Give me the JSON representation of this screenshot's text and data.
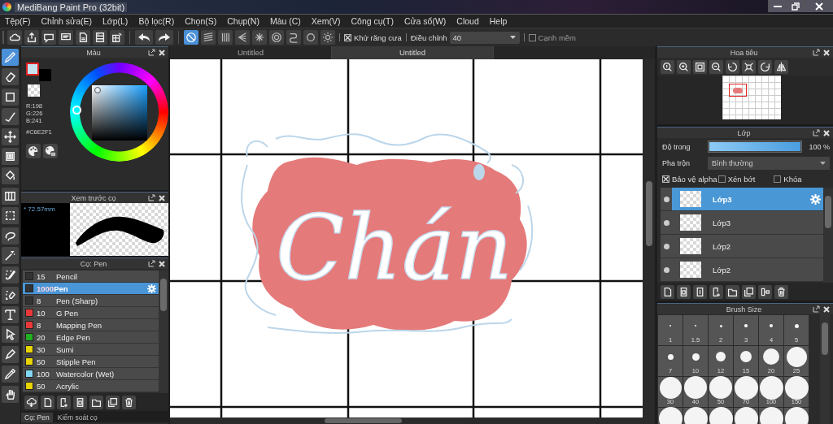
{
  "window": {
    "title": "MediBang Paint Pro (32bit)"
  },
  "menu": [
    "Tệp(F)",
    "Chỉnh sửa(E)",
    "Lớp(L)",
    "Bộ lọc(R)",
    "Chọn(S)",
    "Chụp(N)",
    "Màu (C)",
    "Xem(V)",
    "Công cụ(T)",
    "Cửa sổ(W)",
    "Cloud",
    "Help"
  ],
  "toolbar": {
    "snaps": [
      {
        "selected": true
      },
      {
        "selected": false
      },
      {
        "selected": false
      },
      {
        "selected": false
      },
      {
        "selected": false
      },
      {
        "selected": false
      },
      {
        "selected": false
      },
      {
        "selected": false
      },
      {
        "selected": false
      }
    ],
    "antialias": {
      "label": "Khử răng cưa",
      "checked": true
    },
    "correction": {
      "label": "Điều chỉnh",
      "value": "40"
    },
    "soft_edge": {
      "label": "Cạnh mềm",
      "checked": false
    }
  },
  "tools": [
    {
      "selected": true
    },
    {
      "selected": false
    },
    {
      "selected": false
    },
    {
      "selected": false
    },
    {
      "selected": false
    },
    {
      "selected": false
    },
    {
      "selected": false
    },
    {
      "selected": false
    },
    {
      "selected": false
    },
    {
      "selected": false
    },
    {
      "selected": false
    },
    {
      "selected": false
    },
    {
      "selected": false
    },
    {
      "selected": false
    },
    {
      "selected": false
    },
    {
      "selected": false
    },
    {
      "selected": false
    },
    {
      "selected": false
    }
  ],
  "color_panel": {
    "title": "Màu",
    "r": "R:198",
    "g": "G:226",
    "b": "B:241",
    "hex": "#C6E2F1"
  },
  "brush_preview": {
    "title": "Xem trước cọ",
    "size": "* 72.57mm"
  },
  "brushes": {
    "title": "Cọ: Pen",
    "items": [
      {
        "size": "15",
        "name": "Pencil",
        "color": "#333333",
        "selected": false
      },
      {
        "size": "1000",
        "name": "Pen",
        "color": "#333333",
        "selected": true
      },
      {
        "size": "8",
        "name": "Pen (Sharp)",
        "color": "#333333",
        "selected": false
      },
      {
        "size": "10",
        "name": "G Pen",
        "color": "#e83838",
        "selected": false
      },
      {
        "size": "8",
        "name": "Mapping Pen",
        "color": "#e83838",
        "selected": false
      },
      {
        "size": "20",
        "name": "Edge Pen",
        "color": "#20b020",
        "selected": false
      },
      {
        "size": "30",
        "name": "Sumi",
        "color": "#e8d400",
        "selected": false
      },
      {
        "size": "50",
        "name": "Stipple Pen",
        "color": "#e8d400",
        "selected": false
      },
      {
        "size": "100",
        "name": "Watercolor (Wet)",
        "color": "#80d8f4",
        "selected": false
      },
      {
        "size": "50",
        "name": "Acrylic",
        "color": "#e8d400",
        "selected": false
      }
    ]
  },
  "bottom_tabs": [
    {
      "label": "Cọ: Pen",
      "selected": true
    },
    {
      "label": "Kiểm soát cọ",
      "selected": false
    }
  ],
  "canvas": {
    "tabs": [
      {
        "label": "Untitled",
        "selected": false
      },
      {
        "label": "Untitled",
        "selected": true
      }
    ],
    "lettering": "Chán"
  },
  "navigator": {
    "title": "Hoa tiêu"
  },
  "layers": {
    "title": "Lớp",
    "opacity_label": "Độ trong",
    "level": 1,
    "opacity": "100 %",
    "blend_label": "Pha trộn",
    "blend": "Bình thường",
    "options": [
      {
        "label": "Bảo vệ alpha",
        "checked": true
      },
      {
        "label": "Xén bớt",
        "checked": false
      },
      {
        "label": "Khóa",
        "checked": false
      }
    ],
    "items": [
      {
        "name": "Lớp3",
        "selected": true
      },
      {
        "name": "Lớp3",
        "selected": false
      },
      {
        "name": "Lớp2",
        "selected": false
      },
      {
        "name": "Lớp2",
        "selected": false
      }
    ]
  },
  "brush_size": {
    "title": "Brush Size",
    "sizes": [
      "1",
      "1.5",
      "2",
      "3",
      "4",
      "5",
      "7",
      "10",
      "12",
      "15",
      "20",
      "25",
      "30",
      "40",
      "50",
      "70",
      "100",
      "150"
    ]
  }
}
